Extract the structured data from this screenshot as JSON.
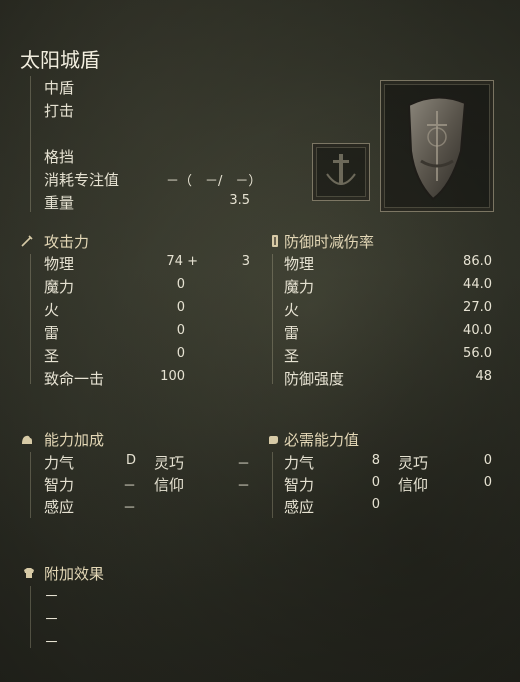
{
  "item": {
    "name": "太阳城盾",
    "type": "中盾",
    "attack_type": "打击",
    "guard_label": "格挡",
    "fp_cost_label": "消耗专注值",
    "fp_cost_value": "－（　－/　－）",
    "weight_label": "重量",
    "weight_value": "3.5"
  },
  "attack": {
    "title": "攻击力",
    "icon": "sword-icon",
    "rows": [
      {
        "label": "物理",
        "value": "74 +",
        "bonus": "3"
      },
      {
        "label": "魔力",
        "value": "0"
      },
      {
        "label": "火",
        "value": "0"
      },
      {
        "label": "雷",
        "value": "0"
      },
      {
        "label": "圣",
        "value": "0"
      },
      {
        "label": "致命一击",
        "value": "100"
      }
    ]
  },
  "defense": {
    "title": "防御时减伤率",
    "icon": "shield-icon",
    "rows": [
      {
        "label": "物理",
        "value": "86.0"
      },
      {
        "label": "魔力",
        "value": "44.0"
      },
      {
        "label": "火",
        "value": "27.0"
      },
      {
        "label": "雷",
        "value": "40.0"
      },
      {
        "label": "圣",
        "value": "56.0"
      },
      {
        "label": "防御强度",
        "value": "48"
      }
    ]
  },
  "scaling": {
    "title": "能力加成",
    "icon": "arm-icon",
    "strength_label": "力气",
    "strength_value": "D",
    "dexterity_label": "灵巧",
    "dexterity_value": "－",
    "intelligence_label": "智力",
    "intelligence_value": "－",
    "faith_label": "信仰",
    "faith_value": "－",
    "arcane_label": "感应",
    "arcane_value": "－"
  },
  "requirements": {
    "title": "必需能力值",
    "icon": "hand-icon",
    "strength_label": "力气",
    "strength_value": "8",
    "dexterity_label": "灵巧",
    "dexterity_value": "0",
    "intelligence_label": "智力",
    "intelligence_value": "0",
    "faith_label": "信仰",
    "faith_value": "0",
    "arcane_label": "感应",
    "arcane_value": "0"
  },
  "effects": {
    "title": "附加效果",
    "icon": "armor-icon",
    "lines": [
      "－",
      "－",
      "－"
    ]
  }
}
